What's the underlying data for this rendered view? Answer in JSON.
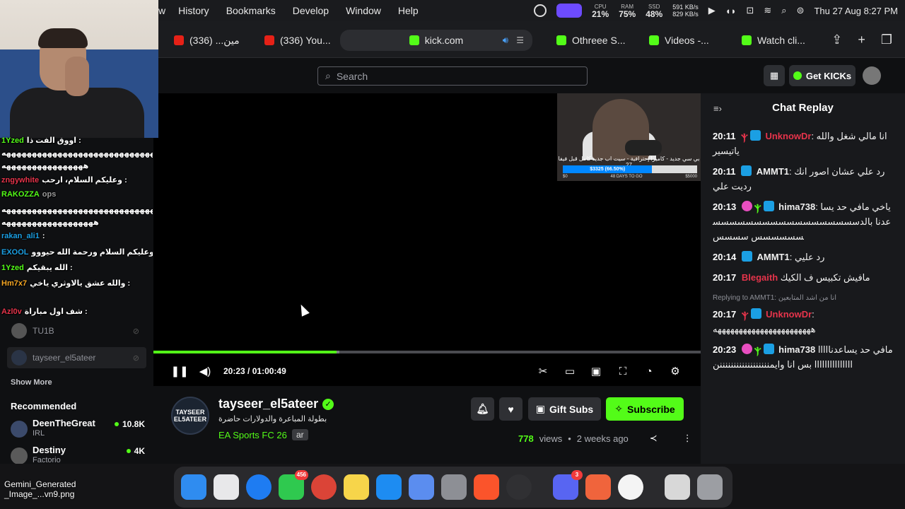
{
  "menubar": {
    "menus": [
      "w",
      "History",
      "Bookmarks",
      "Develop",
      "Window",
      "Help"
    ],
    "cpu": {
      "label": "CPU",
      "value": "21%"
    },
    "ram": {
      "label": "RAM",
      "value": "75%"
    },
    "ssd": {
      "label": "SSD",
      "value": "48%"
    },
    "net_up": "591 KB/s",
    "net_down": "829 KB/s",
    "datetime": "Thu 27 Aug  8:27 PM"
  },
  "tabs": [
    {
      "label": "مين... (336)",
      "icon": "youtube-icon"
    },
    {
      "label": "(336) You...",
      "icon": "youtube-icon"
    },
    {
      "label": "kick.com",
      "icon": "kick-icon",
      "active": true
    },
    {
      "label": "Othreee S...",
      "icon": "kick-icon"
    },
    {
      "label": "Videos -...",
      "icon": "kick-icon"
    },
    {
      "label": "Watch cli...",
      "icon": "kick-icon"
    }
  ],
  "header": {
    "search_placeholder": "Search",
    "get_kicks": "Get KICKs"
  },
  "video": {
    "time_current": "20:23",
    "time_sep": "/",
    "time_total": "01:00:49",
    "played_fraction": 0.335,
    "buffered_fraction": 0.34,
    "inset_caption": "بي سي جديد - كاميرا إحترافية - سيت اب جديد كامل قبل فيفا 27",
    "inset_bar_text": "$3325 (66.50%)",
    "inset_bar_fraction": 0.665,
    "inset_left": "$0",
    "inset_mid": "48 DAYS TO GO",
    "inset_right": "$5000"
  },
  "chat": {
    "title": "Chat Replay",
    "messages": [
      {
        "time": "20:11",
        "user": "UnknowDr",
        "color": "#e6344b",
        "text": "انا مالي شغل والله ياتيسير"
      },
      {
        "time": "20:11",
        "user": "AMMT1",
        "color": "#ffffff",
        "text": "رد علي عشان اصور انك رديت علي"
      },
      {
        "time": "20:13",
        "user": "hima738",
        "color": "#ffffff",
        "text": "ياخي مافي حد يساعدنا بالدسسسسسسسسسسسسسسسسسسسسسسسس سسسس"
      },
      {
        "time": "20:14",
        "user": "AMMT1",
        "color": "#ffffff",
        "text": "رد عليي"
      },
      {
        "time": "20:17",
        "user": "Blegaith",
        "color": "#e6344b",
        "text": "مافيش تكبيس ف الكيك"
      },
      {
        "reply": "Replying to AMMT1: انا من اشد المتابعين",
        "time": "20:17",
        "user": "UnknowDr",
        "color": "#e6344b",
        "text": "هههههههههههههههههههههههه"
      },
      {
        "time": "20:23",
        "user": "hima738",
        "color": "#ffffff",
        "text": "مافي حد يساعدناااااااااااااااااااا بس انا وايمننننننننننننننننننن"
      }
    ]
  },
  "channel": {
    "name": "tayseer_el5ateer",
    "avatar_text": "TAYSEER EL5ATEER",
    "title": "بطولة المباعرة والدولارات حاضرة",
    "category": "EA Sports FC 26",
    "language": "ar",
    "gift_subs": "Gift Subs",
    "subscribe": "Subscribe",
    "views": "778",
    "views_label": "views",
    "dot": "•",
    "ago": "2 weeks ago"
  },
  "sidebar": {
    "items": [
      {
        "name": "TU1B"
      },
      {
        "name": "tayseer_el5ateer",
        "selected": true
      }
    ],
    "show_more": "Show More",
    "recommended_title": "Recommended",
    "recommended": [
      {
        "name": "DeenTheGreat",
        "category": "IRL",
        "viewers": "10.8K"
      },
      {
        "name": "Destiny",
        "category": "Factorio",
        "viewers": "4K"
      }
    ]
  },
  "overlay_chat": [
    {
      "user": "1Yzed",
      "color": "#53fc18",
      "text": "اووق الفت ذا :"
    },
    {
      "user": "",
      "color": "#ffffff",
      "text": "هههههههههههههههههههههههههههههههههه"
    },
    {
      "user": "",
      "color": "#ffffff",
      "text": "ههههههههههههههههه"
    },
    {
      "user": "zngywhite",
      "color": "#e6344b",
      "text": "وعليكم السلام، ارحب :"
    },
    {
      "user": "RAKOZZA",
      "color": "#53fc18",
      "text": "ops"
    },
    {
      "user": "",
      "color": "#ffffff",
      "text": "هههههههههههههههههههههههههههههههههه"
    },
    {
      "user": "",
      "color": "#ffffff",
      "text": "ههههههههههههههههههه"
    },
    {
      "user": "rakan_ali1",
      "color": "#1b9fe3",
      "text": ":"
    },
    {
      "user": "EXOOL",
      "color": "#1b9fe3",
      "text": "وعليكم السلام ورحمة الله حيووو :"
    },
    {
      "user": "1Yzed",
      "color": "#53fc18",
      "text": "الله يبقيكم :"
    },
    {
      "user": "Hm7x7",
      "color": "#f5a623",
      "text": "والله عشق يالاوثري ياخي :"
    },
    {
      "user": "Azl0v",
      "color": "#e6344b",
      "text": "شف اول مباراة :"
    }
  ],
  "desktop": {
    "file_name": "Gemini_Generated _Image_...vn9.png"
  },
  "dock": {
    "messages_badge": "456",
    "discord_badge": "3"
  },
  "colors": {
    "kick_green": "#53fc18",
    "bg": "#0f1012",
    "chat_bg": "#18191c"
  }
}
